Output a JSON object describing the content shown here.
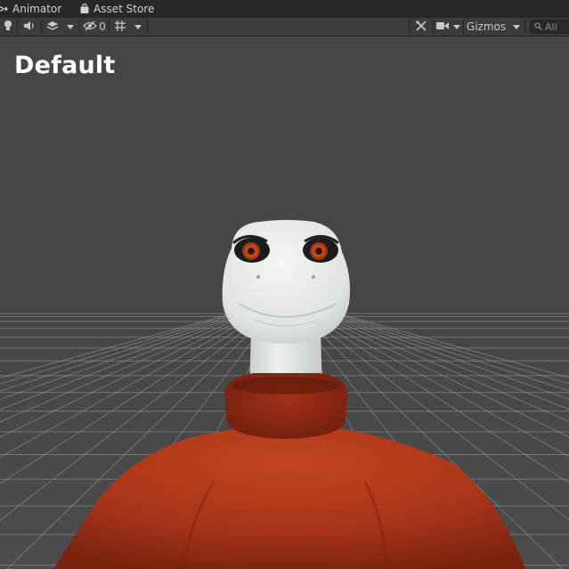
{
  "tabs": [
    {
      "label": "Animator",
      "icon": "animator-icon"
    },
    {
      "label": "Asset Store",
      "icon": "asset-store-bag-icon"
    }
  ],
  "toolbar": {
    "hidden_count": "0",
    "gizmos_label": "Gizmos",
    "search_placeholder": "All"
  },
  "scene": {
    "overlay_title": "Default"
  },
  "colors": {
    "viewport_background": "#464646",
    "grid_line": "#9a9a9a",
    "toolbar": "#3c3c3c",
    "sweater": "#a8341a",
    "skin": "#e6ebe6",
    "iris": "#c8501e"
  }
}
